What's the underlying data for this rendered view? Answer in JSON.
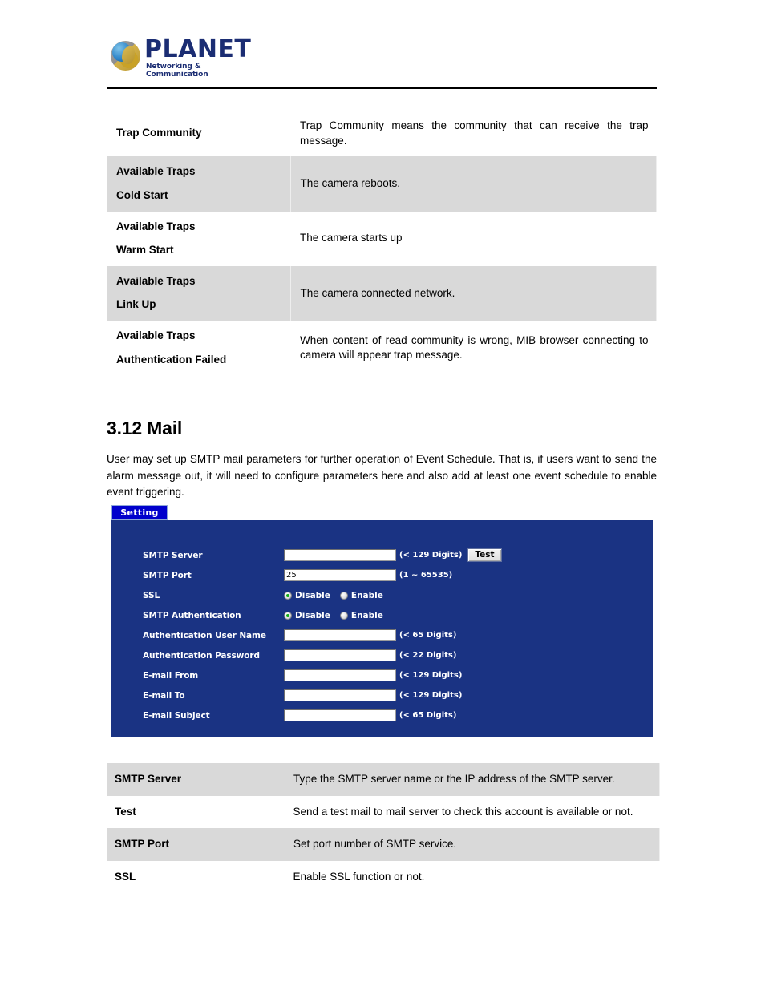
{
  "header": {
    "logo_text": "PLANET",
    "logo_tagline": "Networking & Communication",
    "logo_icon": "planet-globe-logo"
  },
  "traps_table": {
    "rows": [
      {
        "key_lines": [
          "Trap Community"
        ],
        "value": "Trap Community means the community that can receive the trap message.",
        "shaded": false
      },
      {
        "key_lines": [
          "Available Traps",
          "Cold Start"
        ],
        "value": "The camera reboots.",
        "shaded": true
      },
      {
        "key_lines": [
          "Available Traps",
          "Warm Start"
        ],
        "value": "The camera starts up",
        "shaded": false
      },
      {
        "key_lines": [
          "Available Traps",
          "Link Up"
        ],
        "value": "The camera connected network.",
        "shaded": true
      },
      {
        "key_lines": [
          "Available Traps",
          "Authentication Failed"
        ],
        "value": "When content of read community is wrong, MIB browser connecting to camera will appear trap message.",
        "shaded": false
      }
    ]
  },
  "section": {
    "heading": "3.12 Mail",
    "paragraph": "User may set up SMTP mail parameters for further operation of Event Schedule. That is, if users want to send the alarm message out, it will need to configure parameters here and also add at least one event schedule to enable event triggering."
  },
  "ui_shot": {
    "tab_label": "Setting",
    "panel_color": "#1a3383",
    "tab_color": "#0000cc",
    "test_button_label": "Test",
    "rows": [
      {
        "label": "SMTP Server",
        "type": "text",
        "value": "",
        "hint": "(< 129 Digits)",
        "has_test": true
      },
      {
        "label": "SMTP Port",
        "type": "text",
        "value": "25",
        "hint": "(1 ~ 65535)",
        "has_test": false
      },
      {
        "label": "SSL",
        "type": "radio",
        "options": [
          "Disable",
          "Enable"
        ],
        "selected": "Disable"
      },
      {
        "label": "SMTP Authentication",
        "type": "radio",
        "options": [
          "Disable",
          "Enable"
        ],
        "selected": "Disable"
      },
      {
        "label": "Authentication User Name",
        "type": "text",
        "value": "",
        "hint": "(< 65 Digits)",
        "has_test": false
      },
      {
        "label": "Authentication Password",
        "type": "text",
        "value": "",
        "hint": "(< 22 Digits)",
        "has_test": false
      },
      {
        "label": "E-mail From",
        "type": "text",
        "value": "",
        "hint": "(< 129 Digits)",
        "has_test": false
      },
      {
        "label": "E-mail To",
        "type": "text",
        "value": "",
        "hint": "(< 129 Digits)",
        "has_test": false
      },
      {
        "label": "E-mail Subject",
        "type": "text",
        "value": "",
        "hint": "(< 65 Digits)",
        "has_test": false
      }
    ]
  },
  "mail_table": {
    "rows": [
      {
        "key_lines": [
          "SMTP Server"
        ],
        "value": "Type the SMTP server name or the IP address of the SMTP server.",
        "shaded": true
      },
      {
        "key_lines": [
          "Test"
        ],
        "value": "Send a test mail to mail server to check this account is available or not.",
        "shaded": false
      },
      {
        "key_lines": [
          "SMTP Port"
        ],
        "value": "Set port number of SMTP service.",
        "shaded": true
      },
      {
        "key_lines": [
          "SSL"
        ],
        "value": "Enable SSL function or not.",
        "shaded": false
      }
    ]
  }
}
